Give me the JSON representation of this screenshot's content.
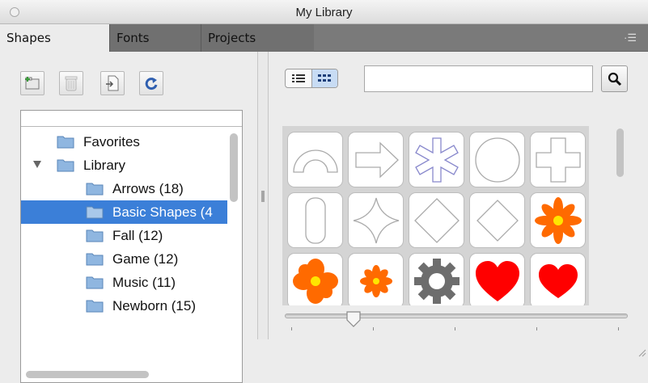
{
  "window": {
    "title": "My Library"
  },
  "tabs": [
    {
      "label": "Shapes",
      "active": true
    },
    {
      "label": "Fonts",
      "active": false
    },
    {
      "label": "Projects",
      "active": false
    }
  ],
  "toolbar": {
    "buttons": [
      {
        "icon": "new-folder-icon"
      },
      {
        "icon": "trash-icon"
      },
      {
        "icon": "import-icon"
      },
      {
        "icon": "refresh-icon"
      }
    ]
  },
  "tree": {
    "items": [
      {
        "label": "Favorites",
        "level": 0,
        "selected": false
      },
      {
        "label": "Library",
        "level": 0,
        "expanded": true,
        "selected": false
      },
      {
        "label": "Arrows (18)",
        "level": 1,
        "selected": false
      },
      {
        "label": "Basic Shapes (4",
        "level": 1,
        "selected": true
      },
      {
        "label": "Fall (12)",
        "level": 1,
        "selected": false
      },
      {
        "label": "Game (12)",
        "level": 1,
        "selected": false
      },
      {
        "label": "Music (11)",
        "level": 1,
        "selected": false
      },
      {
        "label": "Newborn (15)",
        "level": 1,
        "selected": false
      }
    ]
  },
  "view_toggle": {
    "options": [
      "list-view-icon",
      "grid-view-icon"
    ],
    "selected": "grid-view-icon"
  },
  "search": {
    "value": "",
    "placeholder": ""
  },
  "shapes": [
    "arch",
    "arrow",
    "asterisk",
    "circle",
    "cross",
    "rounded-rectangle",
    "four-point-star",
    "diamond",
    "diamond-outline",
    "orange-flower",
    "orange-flower",
    "orange-flower",
    "gear",
    "heart",
    "heart"
  ],
  "colors": {
    "selection": "#3b7fd8",
    "flower_petal": "#ff6a00",
    "flower_center": "#ffe600",
    "heart": "#ff0000",
    "gear": "#6d6d6d"
  },
  "size_slider": {
    "value_fraction": 0.2
  }
}
